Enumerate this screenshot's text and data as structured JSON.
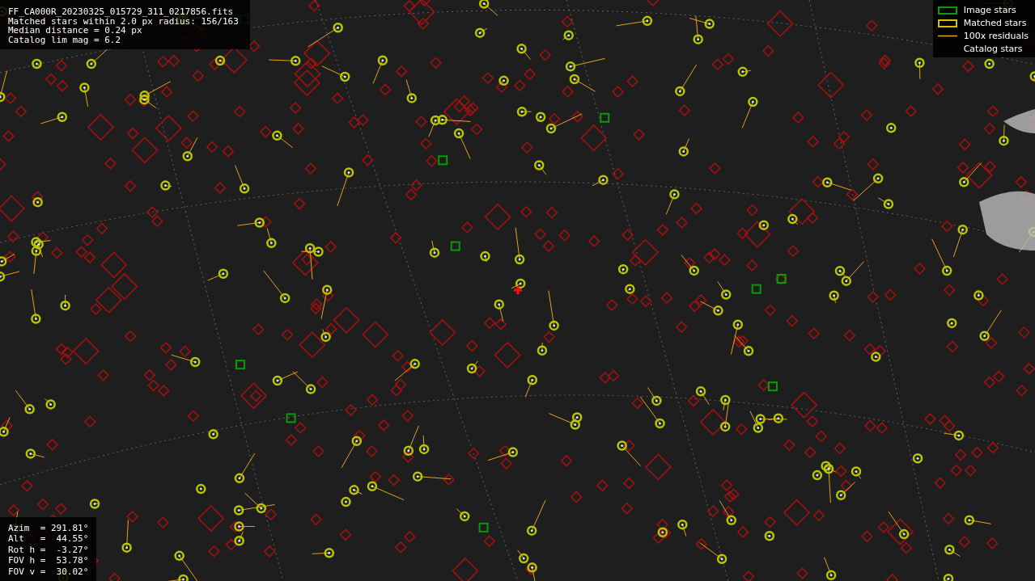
{
  "header": {
    "lines": [
      "FF_CA000R_20230325_015729_311_0217856.fits",
      "Matched stars within 2.0 px radius: 156/163",
      "Median distance = 0.24 px",
      "Catalog lim mag = 6.2"
    ]
  },
  "legend": {
    "items": [
      {
        "kind": "image",
        "label": "Image stars"
      },
      {
        "kind": "matched",
        "label": "Matched stars"
      },
      {
        "kind": "residual",
        "label": "100x residuals"
      },
      {
        "kind": "catalog",
        "label": "Catalog stars"
      }
    ]
  },
  "pointing": {
    "lines": [
      "Azim  = 291.81°",
      "Alt   =  44.55°",
      "Rot h =  -3.27°",
      "FOV h =  53.78°",
      "FOV v =  30.02°"
    ]
  }
}
